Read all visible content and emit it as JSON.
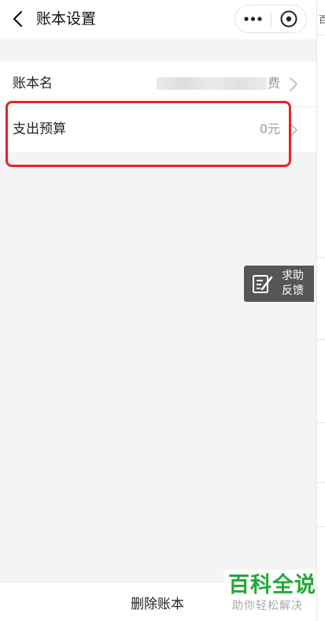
{
  "navbar": {
    "title": "账本设置"
  },
  "settings": {
    "rows": [
      {
        "label": "账本名",
        "value": "费"
      },
      {
        "label": "支出预算",
        "value": "0元"
      }
    ]
  },
  "help": {
    "line1": "求助",
    "line2": "反馈"
  },
  "bottom": {
    "delete_label": "删除账本"
  },
  "watermark": {
    "main": "百科全说",
    "sub": "助你轻松解决"
  },
  "side_strip": {
    "text": "百"
  },
  "colors": {
    "highlight": "#e8222a",
    "watermark_green": "#22a83a",
    "help_bg": "#555658"
  }
}
